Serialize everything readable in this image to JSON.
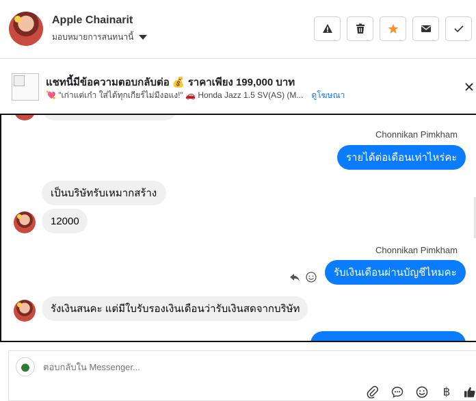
{
  "header": {
    "contact_name": "Apple Chainarit",
    "assign_label": "มอบหมายการสนทนานี้",
    "icons": [
      "warning-icon",
      "trash-icon",
      "star-icon",
      "mail-icon",
      "check-icon"
    ],
    "colors": {
      "star": "#f5922f"
    }
  },
  "ad": {
    "title": "แชทนี้มีข้อความตอบกลับต่อ 💰 ราคาเพียง 199,000 บาท",
    "subtitle": "💘 \"เก่าแต่เก๋า ใส่ได้ทุกเกียร์ไม่มีงอแง!\" 🚗 Honda Jazz 1.5 SV(AS) (M...",
    "link": "ดูโฆษณา",
    "close_icon": "close-icon"
  },
  "messages": [
    {
      "direction": "out",
      "sender": "Chonnikan Pimkham",
      "text": "รายได้ต่อเดือนเท่าไหร่คะ"
    },
    {
      "direction": "in",
      "text": "เป็นบริษัทรับเหมากสร้าง"
    },
    {
      "direction": "in",
      "text": "12000"
    },
    {
      "direction": "out",
      "sender": "Chonnikan Pimkham",
      "text": "รับเงินเดือนผ่านบัญชีไหมคะ"
    },
    {
      "direction": "in",
      "text": "รังเงินสนคะ แต่มีใบรับรองเงินเดือนว่ารับเงินสดจากบริษัท"
    }
  ],
  "composer": {
    "placeholder": "ตอบกลับใน Messenger...",
    "baht_symbol": "฿",
    "tools": [
      "paperclip-icon",
      "chat-bubble-icon",
      "emoji-icon",
      "baht-icon",
      "thumbs-up-icon"
    ]
  },
  "colors": {
    "outgoing_bubble": "#0a7cff",
    "incoming_bubble": "#f0f0f0",
    "link": "#1876f2"
  }
}
